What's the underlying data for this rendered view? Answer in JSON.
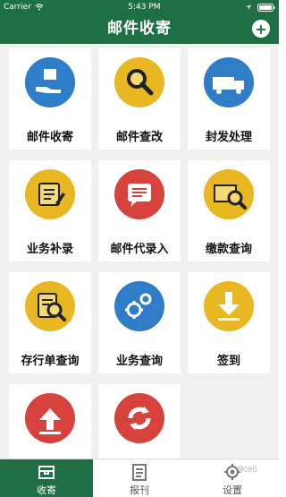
{
  "status_bar": {
    "carrier": "Carrier",
    "time": "5:43 PM"
  },
  "header": {
    "title": "邮件收寄"
  },
  "tiles": [
    {
      "label": "邮件收寄"
    },
    {
      "label": "邮件查改"
    },
    {
      "label": "封发处理"
    },
    {
      "label": "业务补录"
    },
    {
      "label": "邮件代录入"
    },
    {
      "label": "缴款查询"
    },
    {
      "label": "存行单查询"
    },
    {
      "label": "业务查询"
    },
    {
      "label": "签到"
    }
  ],
  "tabs": [
    {
      "label": "收寄"
    },
    {
      "label": "报刊"
    },
    {
      "label": "设置"
    }
  ],
  "watermark": "9ce6",
  "colors": {
    "brand": "#1f6f44",
    "blue": "#2f7dc6",
    "yellow": "#e9b722",
    "red": "#d7423c"
  }
}
